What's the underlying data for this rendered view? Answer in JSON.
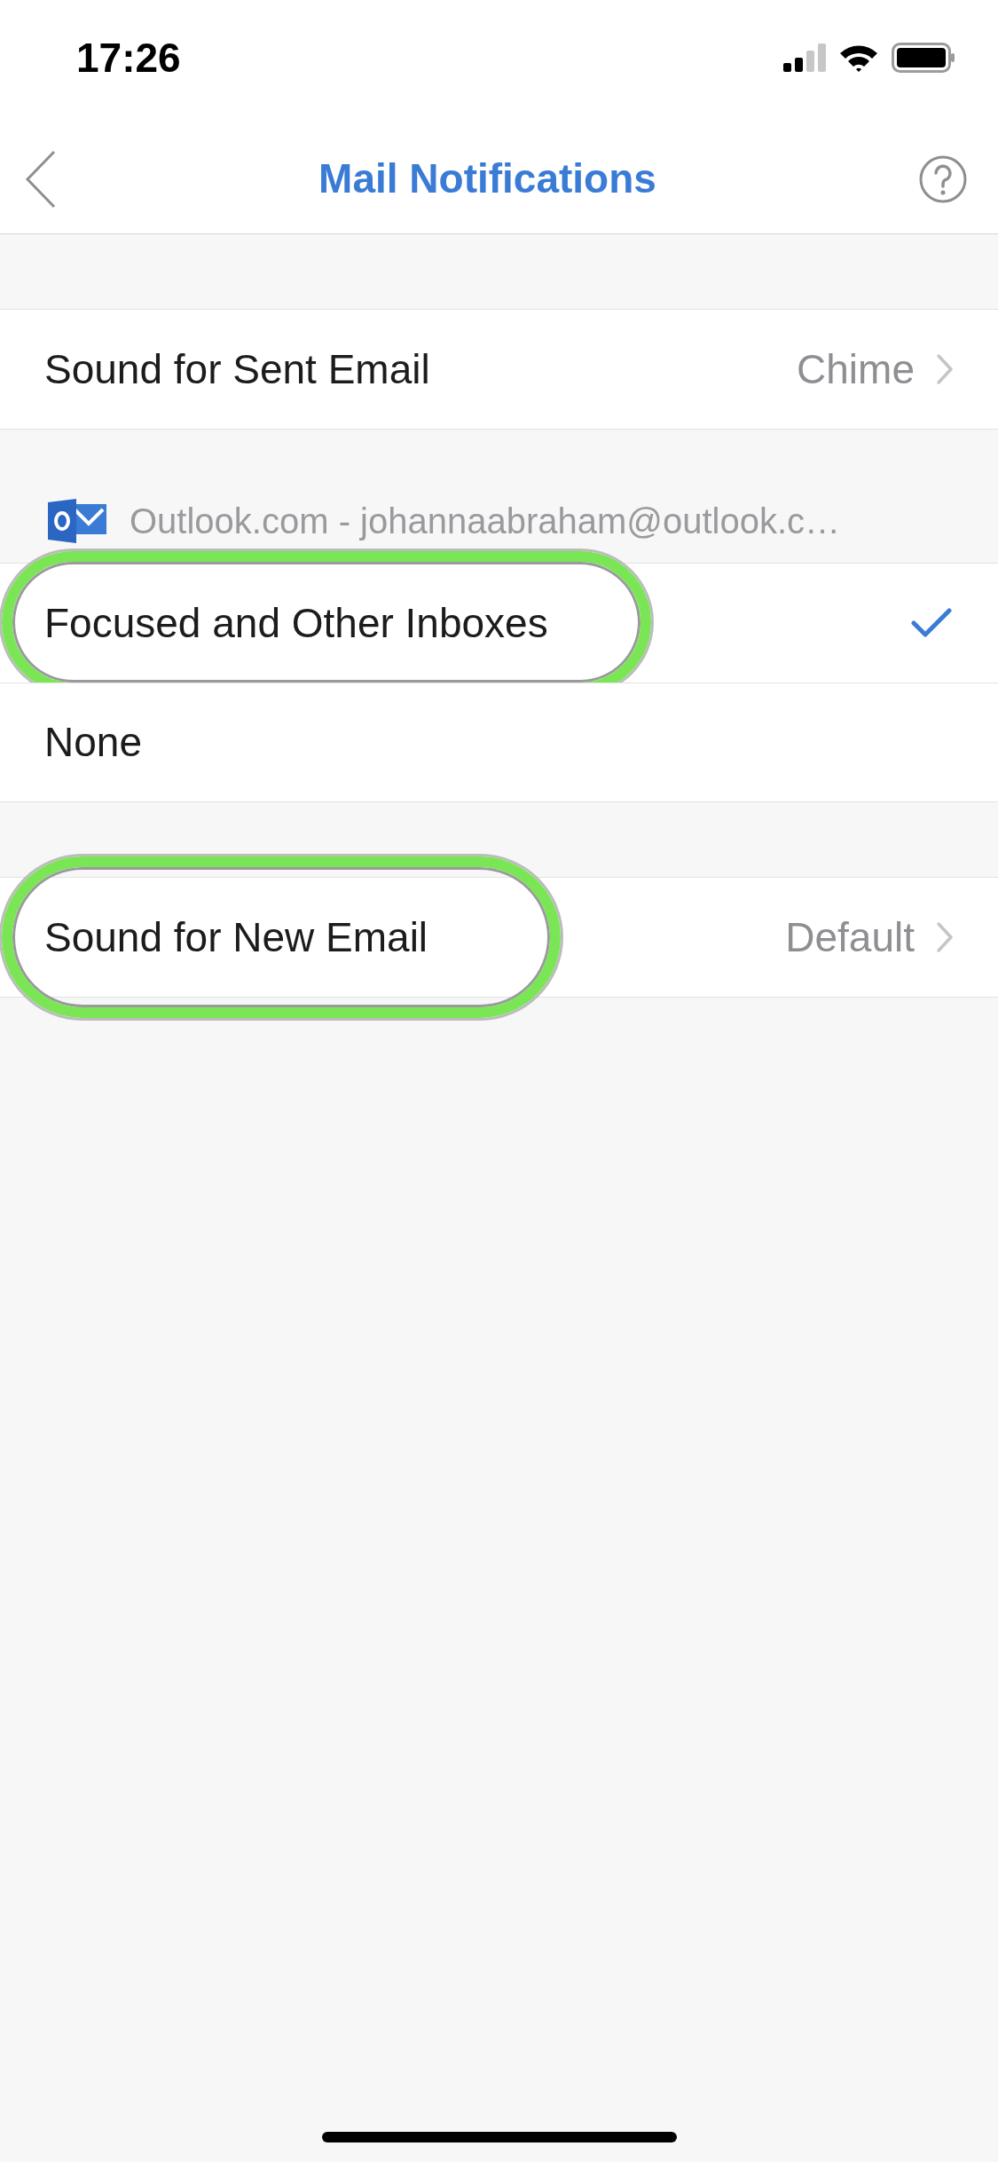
{
  "status_bar": {
    "time": "17:26"
  },
  "nav": {
    "title": "Mail Notifications"
  },
  "sections": [
    {
      "rows": [
        {
          "kind": "value",
          "label": "Sound for Sent Email",
          "value": "Chime",
          "highlighted": false
        }
      ]
    },
    {
      "header": "Outlook.com - johannaabraham@outlook.c…",
      "rows": [
        {
          "kind": "option",
          "label": "Focused and Other Inboxes",
          "selected": true,
          "highlighted": true
        },
        {
          "kind": "option",
          "label": "None",
          "selected": false,
          "highlighted": false
        }
      ]
    },
    {
      "rows": [
        {
          "kind": "value",
          "label": "Sound for New Email",
          "value": "Default",
          "highlighted": true
        }
      ]
    }
  ]
}
